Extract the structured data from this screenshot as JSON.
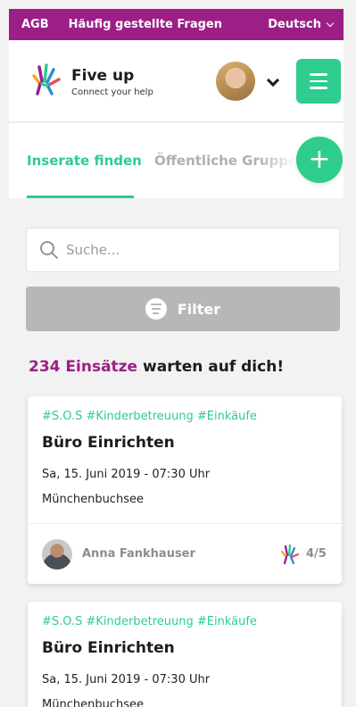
{
  "topbar": {
    "agb": "AGB",
    "faq": "Häufig gestellte Fragen",
    "language": "Deutsch"
  },
  "brand": {
    "name": "Five up",
    "tagline": "Connect your help",
    "logo_icon": "five-hands-logo-icon"
  },
  "tabs": [
    {
      "label": "Inserate finden",
      "active": true
    },
    {
      "label": "Öffentliche Gruppen",
      "active": false
    }
  ],
  "search": {
    "placeholder": "Suche..."
  },
  "filter": {
    "label": "Filter"
  },
  "summary": {
    "count": "234 Einsätze",
    "rest": " warten auf dich!"
  },
  "cards": [
    {
      "tags": "#S.O.S #Kinderbetreuung #Einkäufe",
      "title": "Büro Einrichten",
      "date": "Sa, 15. Juni 2019 - 07:30 Uhr",
      "place": "Münchenbuchsee",
      "person": "Anna Fankhauser",
      "rating": "4/5"
    },
    {
      "tags": "#S.O.S #Kinderbetreuung #Einkäufe",
      "title": "Büro Einrichten",
      "date": "Sa, 15. Juni 2019 - 07:30 Uhr",
      "place": "Münchenbuchsee"
    }
  ],
  "colors": {
    "brand_purple": "#9c1f86",
    "accent_green": "#2ecc8f",
    "filter_gray": "#b7b7b7"
  }
}
